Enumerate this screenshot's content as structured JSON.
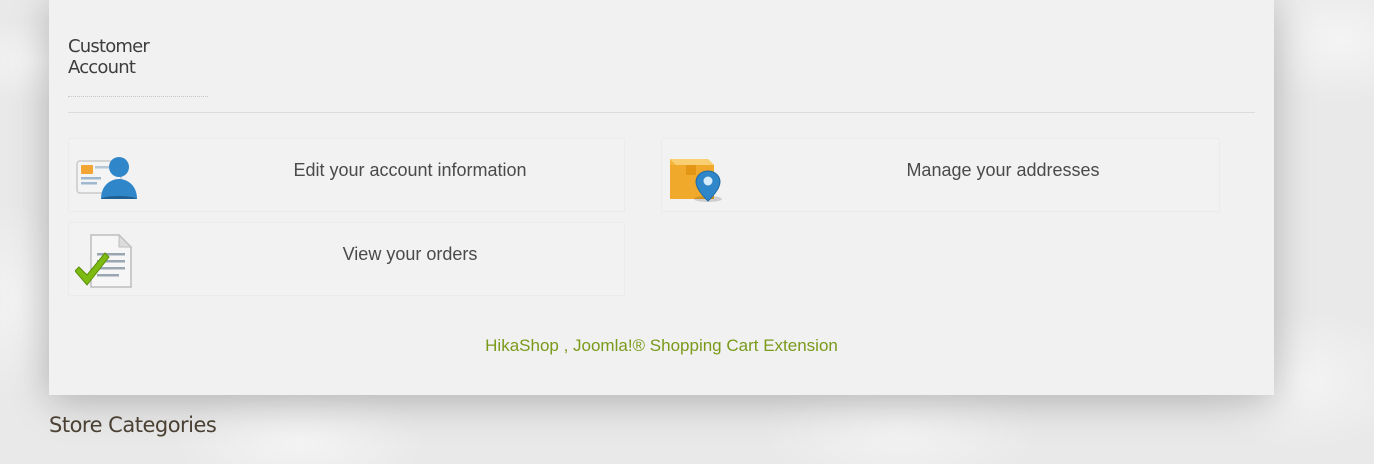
{
  "customer_account": {
    "title": "Customer Account",
    "actions": [
      {
        "label": "Edit your account information",
        "icon": "user-card-icon"
      },
      {
        "label": "Manage your addresses",
        "icon": "address-box-pin-icon"
      },
      {
        "label": "View your orders",
        "icon": "order-document-check-icon"
      }
    ],
    "footer_link": "HikaShop , Joomla!® Shopping Cart Extension"
  },
  "store_categories": {
    "title": "Store Categories"
  },
  "colors": {
    "footer_link": "#7a9a1a",
    "pin_blue": "#2f86c9",
    "box_orange": "#f0a92a",
    "check_green": "#7dbb12"
  }
}
